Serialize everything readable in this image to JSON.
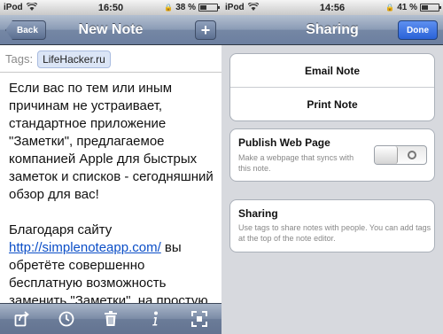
{
  "left": {
    "status": {
      "carrier": "iPod",
      "time": "16:50",
      "battery": "38 %",
      "battery_level": 0.38
    },
    "nav": {
      "back_label": "Back",
      "title": "New Note",
      "add_label": "+"
    },
    "tags": {
      "label": "Tags:",
      "chip": "LifeHacker.ru"
    },
    "note": {
      "para1": "Если вас по тем или иным причинам не устраивает, стандартное приложение \"Заметки\", предлагаемое компанией Apple для быстрых заметок и списков - сегодняшний обзор для вас!",
      "para2_prefix": "Благодаря сайту ",
      "para2_link": "http://simplenoteapp.com/",
      "para2_rest": " вы обретёте совершенно бесплатную возможность заменить \"Заметки\", на простую, красивую и удобную"
    },
    "toolbar": [
      "share-icon",
      "clock-icon",
      "trash-icon",
      "info-icon",
      "fullscreen-icon"
    ]
  },
  "right": {
    "status": {
      "carrier": "iPod",
      "time": "14:56",
      "battery": "41 %",
      "battery_level": 0.41
    },
    "nav": {
      "title": "Sharing",
      "done_label": "Done"
    },
    "actions": {
      "email": "Email Note",
      "print": "Print Note"
    },
    "publish": {
      "title": "Publish Web Page",
      "description": "Make a webpage that syncs with this note.",
      "enabled": false
    },
    "sharing": {
      "title": "Sharing",
      "description": "Use tags to share notes with people. You can add tags at the top of the note editor."
    }
  }
}
